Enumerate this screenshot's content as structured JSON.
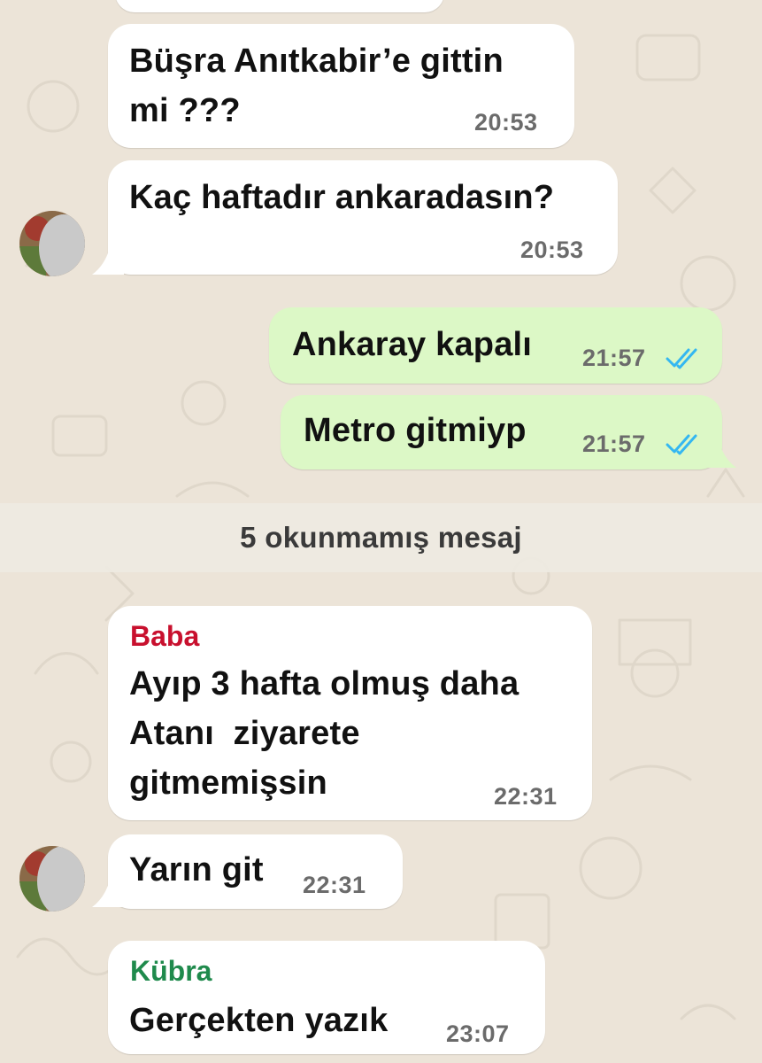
{
  "colors": {
    "background": "#ece4d8",
    "incoming_bubble": "#ffffff",
    "outgoing_bubble": "#dcf8c6",
    "read_ticks": "#34b7f1",
    "sender_baba": "#c8102e",
    "sender_kubra": "#1f8a4c"
  },
  "messages": [
    {
      "text_lines": [
        "Büşra Anıtkabir’e gittin",
        "mi ???"
      ],
      "time": "20:53"
    },
    {
      "text_lines": [
        "Kaç haftadır ankaradasın?"
      ],
      "time": "20:53"
    },
    {
      "text_lines": [
        "Ankaray kapalı"
      ],
      "time": "21:57",
      "status": "read"
    },
    {
      "text_lines": [
        "Metro gitmiyp"
      ],
      "time": "21:57",
      "status": "read"
    },
    {
      "sender": "Baba",
      "text_lines": [
        "Ayıp 3 hafta olmuş daha",
        "Atanı  ziyarete",
        "gitmemişsin"
      ],
      "time": "22:31"
    },
    {
      "text_lines": [
        "Yarın git"
      ],
      "time": "22:31"
    },
    {
      "sender": "Kübra",
      "text_lines": [
        "Gerçekten yazık"
      ],
      "time": "23:07"
    }
  ],
  "unread_banner": "5 okunmamış mesaj",
  "icons": [
    "double-check-icon",
    "contact-avatar",
    "wallpaper-doodles"
  ]
}
